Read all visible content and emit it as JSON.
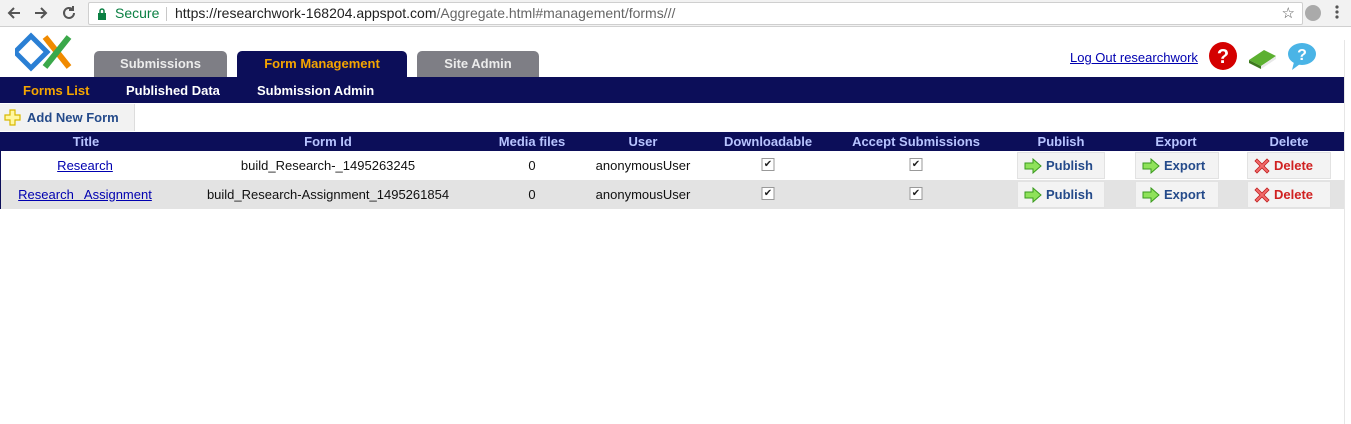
{
  "browser": {
    "secure_label": "Secure",
    "url_host": "https://researchwork-168204.appspot.com",
    "url_path": "/Aggregate.html#management/forms///"
  },
  "header": {
    "tabs": [
      {
        "label": "Submissions",
        "active": false
      },
      {
        "label": "Form Management",
        "active": true
      },
      {
        "label": "Site Admin",
        "active": false
      }
    ],
    "logout_label": "Log Out researchwork"
  },
  "subnav": {
    "items": [
      {
        "label": "Forms List",
        "active": true
      },
      {
        "label": "Published Data",
        "active": false
      },
      {
        "label": "Submission Admin",
        "active": false
      }
    ]
  },
  "toolbar": {
    "add_form_label": "Add New Form"
  },
  "table": {
    "columns": [
      "Title",
      "Form Id",
      "Media files",
      "User",
      "Downloadable",
      "Accept Submissions",
      "Publish",
      "Export",
      "Delete"
    ],
    "rows": [
      {
        "title": "Research",
        "form_id": "build_Research-_1495263245",
        "media_files": "0",
        "user": "anonymousUser",
        "downloadable": true,
        "accept_submissions": true,
        "publish_label": "Publish",
        "export_label": "Export",
        "delete_label": "Delete"
      },
      {
        "title": "Research   Assignment",
        "form_id": "build_Research-Assignment_1495261854",
        "media_files": "0",
        "user": "anonymousUser",
        "downloadable": true,
        "accept_submissions": true,
        "publish_label": "Publish",
        "export_label": "Export",
        "delete_label": "Delete"
      }
    ]
  },
  "colors": {
    "navy": "#0c0e59",
    "accent_orange": "#f5a500",
    "header_text": "#b8c4ff",
    "row_alt": "#e3e3e3"
  },
  "icons": {
    "back": "arrow-left-icon",
    "forward": "arrow-right-icon",
    "reload": "reload-icon",
    "lock": "lock-icon",
    "bookmark": "star-icon",
    "help": "question-icon",
    "book": "book-icon",
    "chat_help": "chat-help-icon",
    "add": "plus-icon",
    "publish": "green-arrow-icon",
    "delete": "red-x-icon"
  }
}
